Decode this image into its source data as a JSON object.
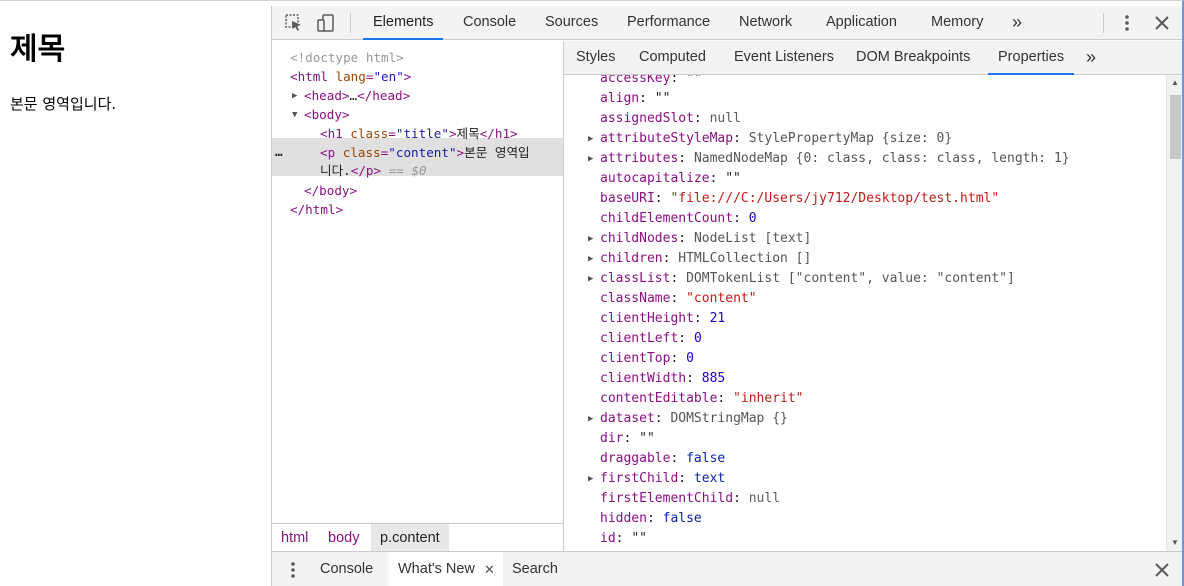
{
  "page": {
    "heading": "제목",
    "paragraph": "본문 영역입니다."
  },
  "devtools": {
    "main_tabs": [
      "Elements",
      "Console",
      "Sources",
      "Performance",
      "Network",
      "Application",
      "Memory"
    ],
    "active_main_tab": "Elements",
    "more_tabs": "»",
    "dom_tree": {
      "doctype": "<!doctype html>",
      "html_open_tag": "<html",
      "html_lang_attr": "lang",
      "html_lang_val": "\"en\"",
      "head_open": "<head>",
      "head_ellipsis": "…",
      "head_close": "</head>",
      "body_open": "<body>",
      "h1_tag": "<h1",
      "h1_class_attr": "class",
      "h1_class_val": "\"title\"",
      "h1_text": "제목",
      "h1_close": "</h1>",
      "p_tag": "<p",
      "p_class_attr": "class",
      "p_class_val": "\"content\"",
      "p_text_1": "본문 영역입",
      "p_text_2": "니다.",
      "p_close": "</p>",
      "selected_marker": "== $0",
      "row_ellipsis": "…",
      "body_close": "</body>",
      "html_close": "</html>"
    },
    "breadcrumb": [
      "html",
      "body",
      "p.content"
    ],
    "side_tabs": [
      "Styles",
      "Computed",
      "Event Listeners",
      "DOM Breakpoints",
      "Properties"
    ],
    "active_side_tab": "Properties",
    "properties": [
      {
        "key": "accessKey",
        "value": "\"\"",
        "type": "q",
        "expandable": false
      },
      {
        "key": "align",
        "value": "\"\"",
        "type": "q",
        "expandable": false
      },
      {
        "key": "assignedSlot",
        "value": "null",
        "type": "null",
        "expandable": false
      },
      {
        "key": "attributeStyleMap",
        "value": "StylePropertyMap {size: 0}",
        "type": "obj",
        "expandable": true
      },
      {
        "key": "attributes",
        "value": "NamedNodeMap {0: class, class: class, length: 1}",
        "type": "obj",
        "expandable": true
      },
      {
        "key": "autocapitalize",
        "value": "\"\"",
        "type": "q",
        "expandable": false
      },
      {
        "key": "baseURI",
        "value": "\"file:///C:/Users/jy712/Desktop/test.html\"",
        "type": "str",
        "expandable": false
      },
      {
        "key": "childElementCount",
        "value": "0",
        "type": "num",
        "expandable": false
      },
      {
        "key": "childNodes",
        "value": "NodeList [text]",
        "type": "obj",
        "expandable": true
      },
      {
        "key": "children",
        "value": "HTMLCollection []",
        "type": "obj",
        "expandable": true
      },
      {
        "key": "classList",
        "value": "DOMTokenList [\"content\", value: \"content\"]",
        "type": "obj",
        "expandable": true
      },
      {
        "key": "className",
        "value": "\"content\"",
        "type": "str",
        "expandable": false
      },
      {
        "key": "clientHeight",
        "value": "21",
        "type": "num",
        "expandable": false
      },
      {
        "key": "clientLeft",
        "value": "0",
        "type": "num",
        "expandable": false
      },
      {
        "key": "clientTop",
        "value": "0",
        "type": "num",
        "expandable": false
      },
      {
        "key": "clientWidth",
        "value": "885",
        "type": "num",
        "expandable": false
      },
      {
        "key": "contentEditable",
        "value": "\"inherit\"",
        "type": "str",
        "expandable": false
      },
      {
        "key": "dataset",
        "value": "DOMStringMap {}",
        "type": "obj",
        "expandable": true
      },
      {
        "key": "dir",
        "value": "\"\"",
        "type": "q",
        "expandable": false
      },
      {
        "key": "draggable",
        "value": "false",
        "type": "kw",
        "expandable": false
      },
      {
        "key": "firstChild",
        "value": "text",
        "type": "kw",
        "expandable": true
      },
      {
        "key": "firstElementChild",
        "value": "null",
        "type": "null",
        "expandable": false
      },
      {
        "key": "hidden",
        "value": "false",
        "type": "kw",
        "expandable": false
      },
      {
        "key": "id",
        "value": "\"\"",
        "type": "q",
        "expandable": false
      }
    ],
    "drawer_tabs": [
      "Console",
      "What's New",
      "Search"
    ],
    "active_drawer_tab": "What's New",
    "icons": {
      "inspect": "inspect-element-icon",
      "device": "device-toolbar-icon",
      "menu": "kebab-menu-icon",
      "close": "close-icon"
    }
  }
}
